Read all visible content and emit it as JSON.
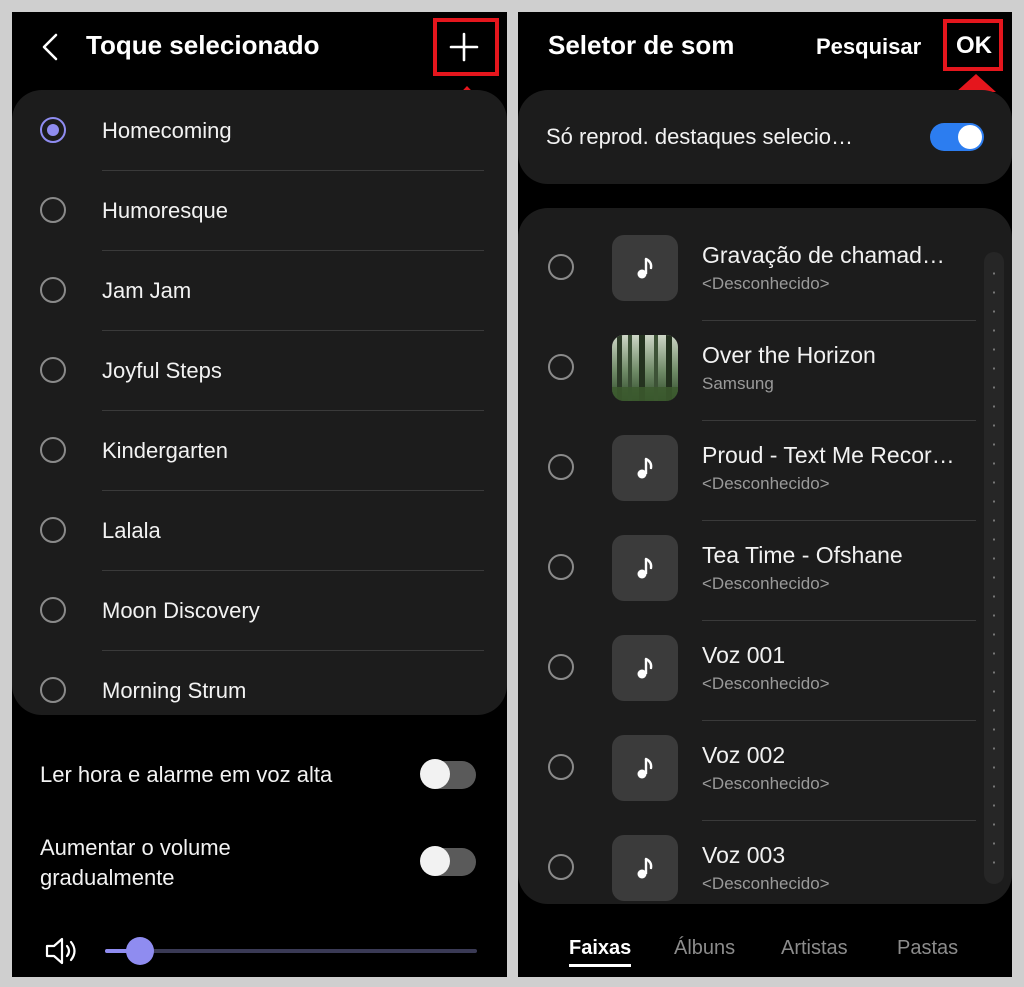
{
  "left": {
    "header": {
      "title": "Toque selecionado"
    },
    "ringtones": [
      {
        "label": "Homecoming",
        "selected": true
      },
      {
        "label": "Humoresque",
        "selected": false
      },
      {
        "label": "Jam Jam",
        "selected": false
      },
      {
        "label": "Joyful Steps",
        "selected": false
      },
      {
        "label": "Kindergarten",
        "selected": false
      },
      {
        "label": "Lalala",
        "selected": false
      },
      {
        "label": "Moon Discovery",
        "selected": false
      },
      {
        "label": "Morning Strum",
        "selected": false
      }
    ],
    "settings": {
      "read_time_label": "Ler hora e alarme em voz alta",
      "read_time_on": false,
      "increase_volume_line1": "Aumentar o volume",
      "increase_volume_line2": "gradualmente",
      "increase_volume_on": false
    },
    "volume": {
      "level": 0.06
    }
  },
  "right": {
    "header": {
      "title": "Seletor de som",
      "search_label": "Pesquisar",
      "ok_label": "OK"
    },
    "highlights": {
      "label": "Só reprod. destaques selecio…",
      "on": true
    },
    "tracks": [
      {
        "title": "Gravação de chamad…",
        "subtitle": "<Desconhecido>",
        "thumb": "music-note-icon"
      },
      {
        "title": "Over the Horizon",
        "subtitle": "Samsung",
        "thumb": "album-art-forest"
      },
      {
        "title": "Proud - Text Me Recor…",
        "subtitle": "<Desconhecido>",
        "thumb": "music-note-icon"
      },
      {
        "title": "Tea Time - Ofshane",
        "subtitle": "<Desconhecido>",
        "thumb": "music-note-icon"
      },
      {
        "title": "Voz 001",
        "subtitle": "<Desconhecido>",
        "thumb": "music-note-icon"
      },
      {
        "title": "Voz 002",
        "subtitle": "<Desconhecido>",
        "thumb": "music-note-icon"
      },
      {
        "title": "Voz 003",
        "subtitle": "<Desconhecido>",
        "thumb": "music-note-icon"
      }
    ],
    "tabs": [
      {
        "label": "Faixas",
        "active": true
      },
      {
        "label": "Álbuns",
        "active": false
      },
      {
        "label": "Artistas",
        "active": false
      },
      {
        "label": "Pastas",
        "active": false
      }
    ]
  },
  "colors": {
    "accent_purple": "#8f8cf0",
    "switch_blue": "#2c7df0",
    "highlight_red": "#e5161d",
    "card": "#1c1c1c"
  }
}
